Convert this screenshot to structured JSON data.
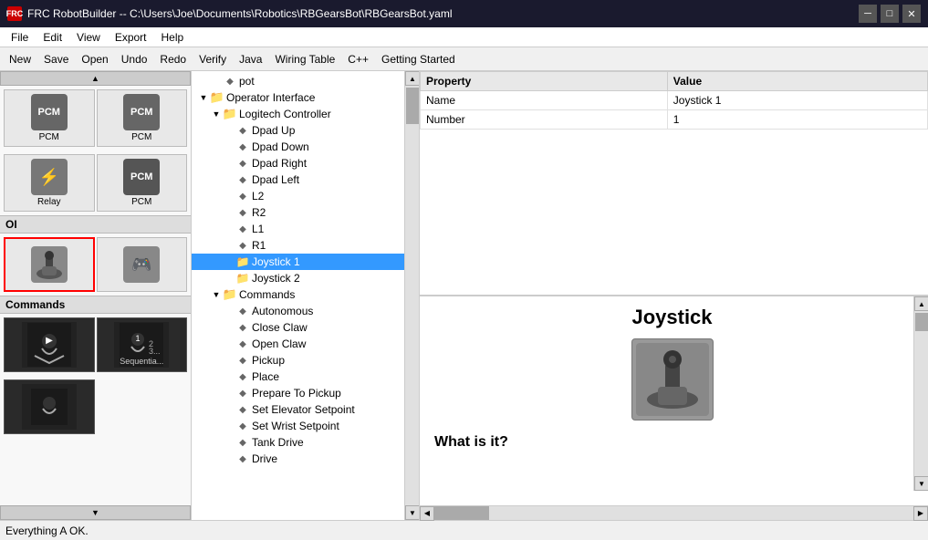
{
  "titlebar": {
    "icon": "FRC",
    "title": "FRC RobotBuilder -- C:\\Users\\Joe\\Documents\\Robotics\\RBGearsBot\\RBGearsBot.yaml",
    "min_btn": "─",
    "max_btn": "□",
    "close_btn": "✕"
  },
  "menubar": {
    "items": [
      "File",
      "Edit",
      "View",
      "Export",
      "Help"
    ]
  },
  "toolbar": {
    "buttons": [
      "New",
      "Save",
      "Open",
      "Undo",
      "Redo",
      "Verify",
      "Java",
      "Wiring Table",
      "C++",
      "Getting Started"
    ]
  },
  "palette": {
    "top_items": [
      {
        "label": "PCM",
        "icon": "🔧"
      },
      {
        "label": "PCM",
        "icon": "⚙"
      }
    ],
    "relay_items": [
      {
        "label": "Relay",
        "icon": "⚡"
      },
      {
        "label": "PCM",
        "icon": "⚙"
      }
    ],
    "oi_section": "OI",
    "oi_items": [
      {
        "label": "",
        "icon": "🕹",
        "selected": true
      },
      {
        "label": "",
        "icon": "🎮"
      }
    ],
    "commands_section": "Commands",
    "cmd_items": [
      {
        "label": "",
        "icon": "▶"
      },
      {
        "label": "Sequentia...",
        "icon": "▶▶"
      }
    ]
  },
  "tree": {
    "items": [
      {
        "level": 0,
        "type": "leaf",
        "label": "pot",
        "icon": "dot"
      },
      {
        "level": 0,
        "type": "folder",
        "label": "Operator Interface",
        "expanded": true,
        "icon": "folder"
      },
      {
        "level": 1,
        "type": "folder",
        "label": "Logitech Controller",
        "expanded": true,
        "icon": "folder"
      },
      {
        "level": 2,
        "type": "leaf",
        "label": "Dpad Up",
        "icon": "dot"
      },
      {
        "level": 2,
        "type": "leaf",
        "label": "Dpad Down",
        "icon": "dot"
      },
      {
        "level": 2,
        "type": "leaf",
        "label": "Dpad Right",
        "icon": "dot"
      },
      {
        "level": 2,
        "type": "leaf",
        "label": "Dpad Left",
        "icon": "dot"
      },
      {
        "level": 2,
        "type": "leaf",
        "label": "L2",
        "icon": "dot"
      },
      {
        "level": 2,
        "type": "leaf",
        "label": "R2",
        "icon": "dot"
      },
      {
        "level": 2,
        "type": "leaf",
        "label": "L1",
        "icon": "dot"
      },
      {
        "level": 2,
        "type": "leaf",
        "label": "R1",
        "icon": "dot"
      },
      {
        "level": 2,
        "type": "leaf",
        "label": "Joystick 1",
        "icon": "folder",
        "selected": true
      },
      {
        "level": 2,
        "type": "leaf",
        "label": "Joystick 2",
        "icon": "folder"
      },
      {
        "level": 1,
        "type": "folder",
        "label": "Commands",
        "expanded": true,
        "icon": "folder"
      },
      {
        "level": 2,
        "type": "leaf",
        "label": "Autonomous",
        "icon": "dot"
      },
      {
        "level": 2,
        "type": "leaf",
        "label": "Close Claw",
        "icon": "dot"
      },
      {
        "level": 2,
        "type": "leaf",
        "label": "Open Claw",
        "icon": "dot"
      },
      {
        "level": 2,
        "type": "leaf",
        "label": "Pickup",
        "icon": "dot"
      },
      {
        "level": 2,
        "type": "leaf",
        "label": "Place",
        "icon": "dot"
      },
      {
        "level": 2,
        "type": "leaf",
        "label": "Prepare To Pickup",
        "icon": "dot"
      },
      {
        "level": 2,
        "type": "leaf",
        "label": "Set Elevator Setpoint",
        "icon": "dot"
      },
      {
        "level": 2,
        "type": "leaf",
        "label": "Set Wrist Setpoint",
        "icon": "dot"
      },
      {
        "level": 2,
        "type": "leaf",
        "label": "Tank Drive",
        "icon": "dot"
      },
      {
        "level": 2,
        "type": "leaf",
        "label": "Drive",
        "icon": "dot"
      }
    ]
  },
  "properties": {
    "columns": [
      "Property",
      "Value"
    ],
    "rows": [
      {
        "property": "Name",
        "value": "Joystick 1"
      },
      {
        "property": "Number",
        "value": "1"
      }
    ]
  },
  "help": {
    "title": "Joystick",
    "subtitle": "What is it?",
    "image_icon": "🕹"
  },
  "statusbar": {
    "text": "Everything A OK."
  }
}
